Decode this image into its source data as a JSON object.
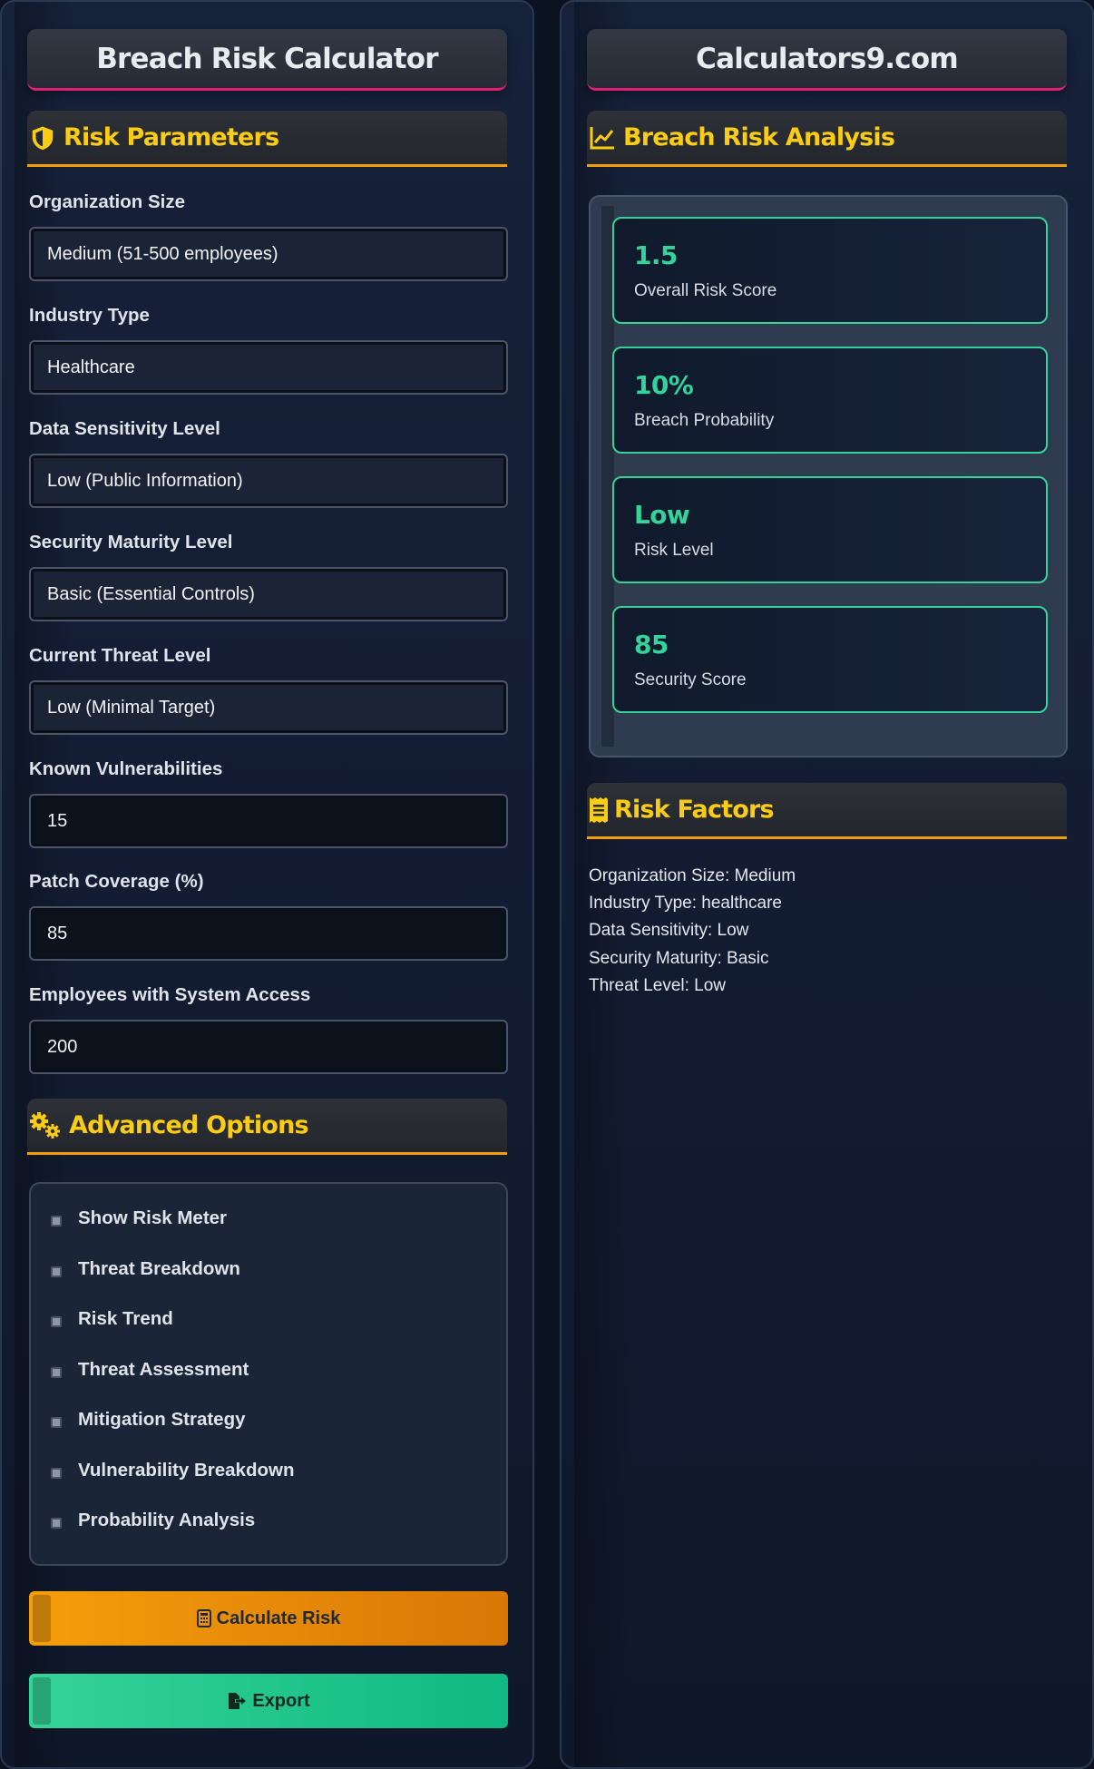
{
  "left": {
    "title": "Breach Risk Calculator",
    "params_heading": "Risk Parameters",
    "fields": [
      {
        "label": "Organization Size",
        "value": "Medium (51-500 employees)"
      },
      {
        "label": "Industry Type",
        "value": "Healthcare"
      },
      {
        "label": "Data Sensitivity Level",
        "value": "Low (Public Information)"
      },
      {
        "label": "Security Maturity Level",
        "value": "Basic (Essential Controls)"
      },
      {
        "label": "Current Threat Level",
        "value": "Low (Minimal Target)"
      },
      {
        "label": "Known Vulnerabilities",
        "value": "15"
      },
      {
        "label": "Patch Coverage (%)",
        "value": "85"
      },
      {
        "label": "Employees with System Access",
        "value": "200"
      }
    ],
    "advanced_heading": "Advanced Options",
    "options": [
      "Show Risk Meter",
      "Threat Breakdown",
      "Risk Trend",
      "Threat Assessment",
      "Mitigation Strategy",
      "Vulnerability Breakdown",
      "Probability Analysis"
    ],
    "calculate_label": "Calculate Risk",
    "export_label": "Export"
  },
  "right": {
    "title": "Calculators9.com",
    "analysis_heading": "Breach Risk Analysis",
    "results": [
      {
        "value": "1.5",
        "label": "Overall Risk Score"
      },
      {
        "value": "10%",
        "label": "Breach Probability"
      },
      {
        "value": "Low",
        "label": "Risk Level"
      },
      {
        "value": "85",
        "label": "Security Score"
      }
    ],
    "factors_heading": "Risk Factors",
    "factors": [
      "Organization Size: Medium",
      "Industry Type: healthcare",
      "Data Sensitivity: Low",
      "Security Maturity: Basic",
      "Threat Level: Low"
    ]
  },
  "colors": {
    "accent_yellow": "#facc15",
    "accent_orange": "#f59e0b",
    "accent_green": "#34d399",
    "accent_pink": "#e11d74",
    "background": "#0b1220"
  },
  "icons": [
    "shield-icon",
    "gears-icon",
    "calculator-icon",
    "export-icon",
    "chart-line-icon",
    "receipt-icon"
  ]
}
